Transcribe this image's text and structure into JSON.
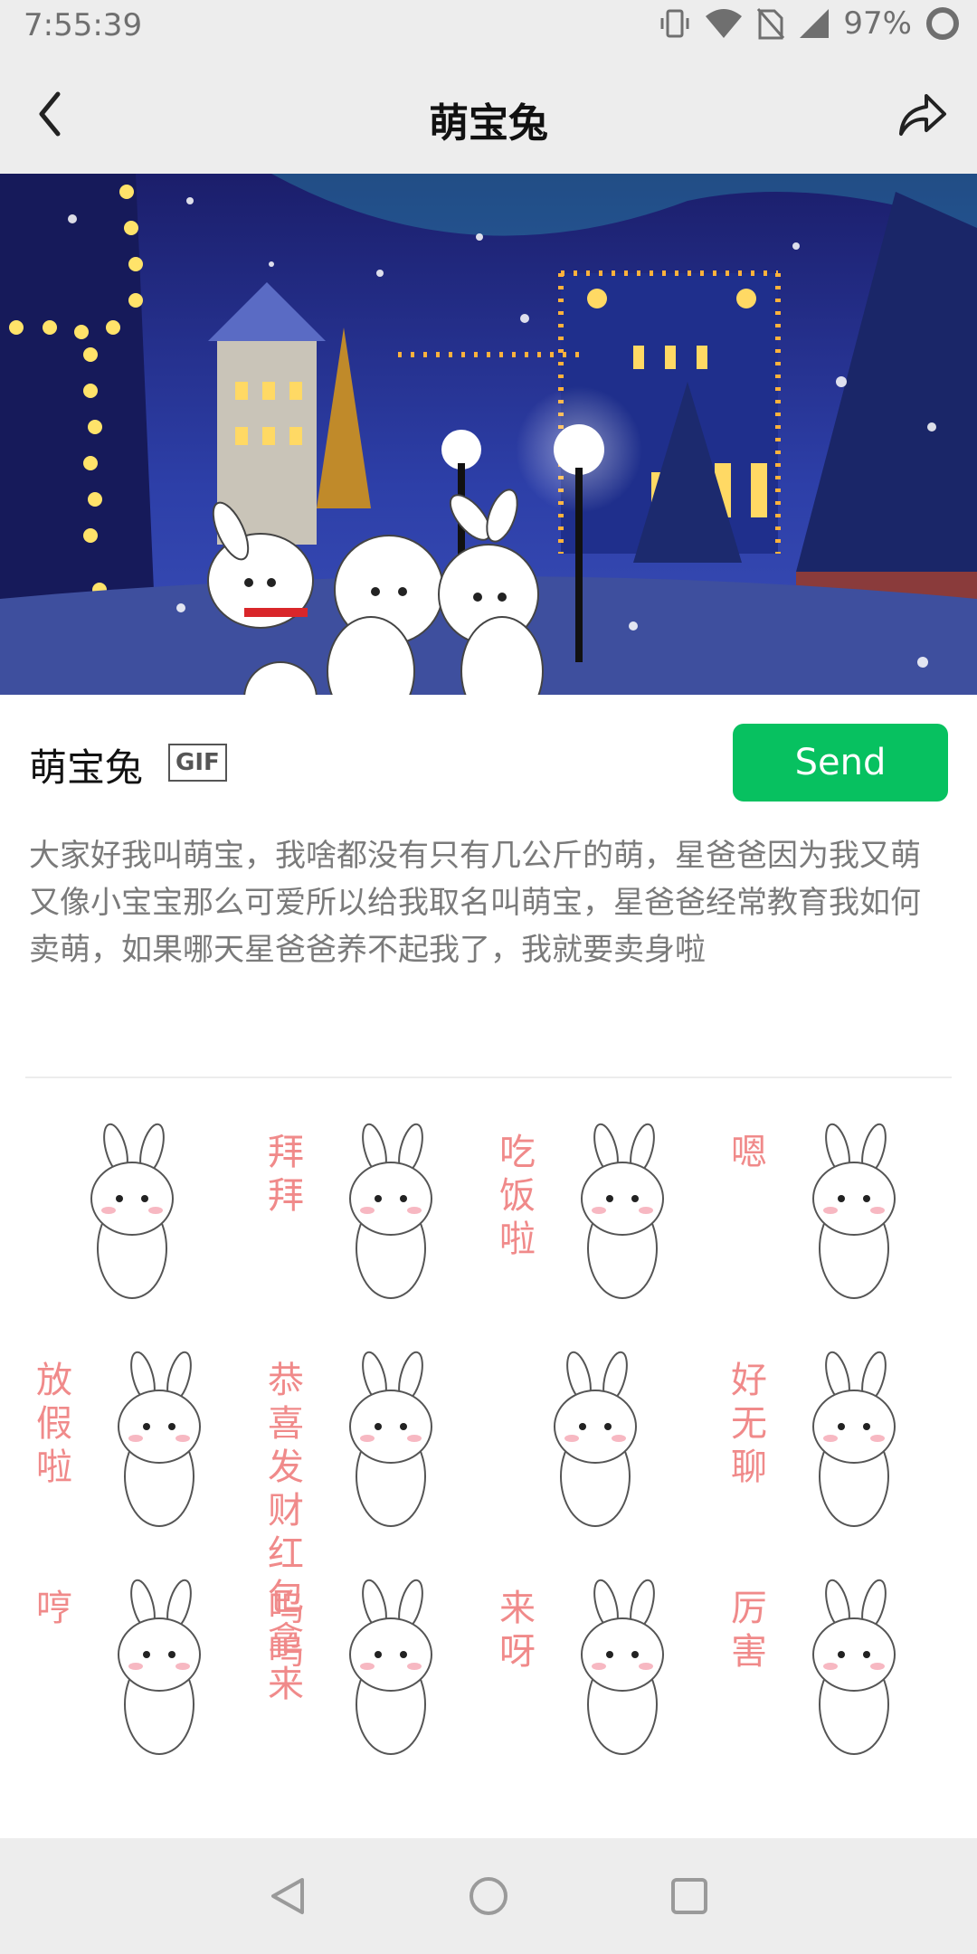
{
  "status_bar": {
    "time": "7:55:39",
    "battery": "97%"
  },
  "nav": {
    "title": "萌宝兔"
  },
  "sticker": {
    "name": "萌宝兔",
    "badge": "GIF",
    "send_label": "Send",
    "description": "大家好我叫萌宝，我啥都没有只有几公斤的萌，星爸爸因为我又萌又像小宝宝那么可爱所以给我取名叫萌宝，星爸爸经常教育我如何卖萌，如果哪天星爸爸养不起我了，我就要卖身啦"
  },
  "stickers": [
    {
      "caption": ""
    },
    {
      "caption": "拜拜"
    },
    {
      "caption": "吃饭啦"
    },
    {
      "caption": "嗯"
    },
    {
      "caption": "放假啦"
    },
    {
      "caption": "恭喜发财 红包拿来"
    },
    {
      "caption": ""
    },
    {
      "caption": "好无聊"
    },
    {
      "caption": "哼"
    },
    {
      "caption": "呜呜"
    },
    {
      "caption": "来呀"
    },
    {
      "caption": "厉害"
    }
  ],
  "colors": {
    "accent": "#07c160",
    "caption": "#f08a8a",
    "bar": "#ededed"
  }
}
